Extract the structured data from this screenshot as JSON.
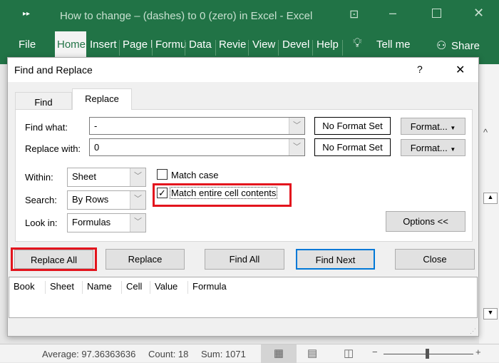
{
  "window": {
    "title": "How to change – (dashes) to 0 (zero) in Excel  -  Excel"
  },
  "ribbon": {
    "tabs": [
      "File",
      "Home",
      "Insert",
      "Page l",
      "Formu",
      "Data",
      "Revie",
      "View",
      "Devel",
      "Help"
    ],
    "tell_me": "Tell me",
    "share": "Share"
  },
  "dialog": {
    "title": "Find and Replace",
    "help": "?",
    "close": "✕",
    "tabs": [
      "Find",
      "Replace"
    ],
    "find_label": "Find what:",
    "find_value": "-",
    "replace_label": "Replace with:",
    "replace_value": "0",
    "no_format": "No Format Set",
    "format_btn": "Format...",
    "within_label": "Within:",
    "within_value": "Sheet",
    "search_label": "Search:",
    "search_value": "By Rows",
    "lookin_label": "Look in:",
    "lookin_value": "Formulas",
    "match_case": "Match case",
    "match_case_checked": false,
    "match_entire": "Match entire cell contents",
    "match_entire_checked": true,
    "options": "Options <<",
    "buttons": {
      "replace_all": "Replace All",
      "replace": "Replace",
      "find_all": "Find All",
      "find_next": "Find Next",
      "close": "Close"
    },
    "columns": [
      "Book",
      "Sheet",
      "Name",
      "Cell",
      "Value",
      "Formula"
    ]
  },
  "status": {
    "average": "Average: 97.36363636",
    "count": "Count: 18",
    "sum": "Sum: 1071"
  },
  "colors": {
    "excel_green": "#217346",
    "highlight": "#e3141d"
  }
}
